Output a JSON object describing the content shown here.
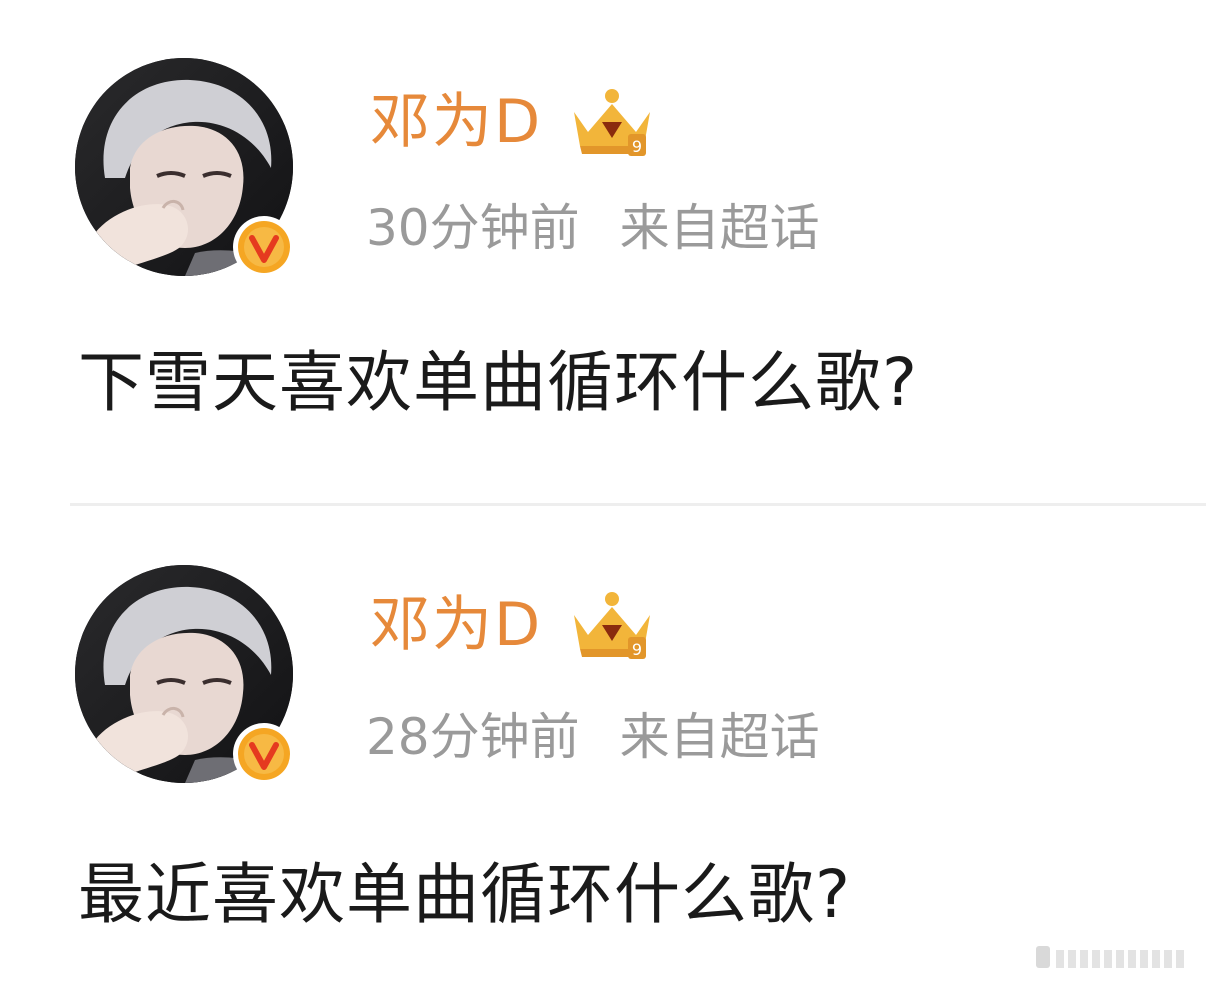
{
  "colors": {
    "username": "#e6893a",
    "meta": "#9a9a9a",
    "text": "#1a1a1a",
    "verified": "#f5a623",
    "crown": "#f2b53a"
  },
  "posts": [
    {
      "username": "邓为D",
      "time": "30分钟前",
      "source": "来自超话",
      "text": "下雪天喜欢单曲循环什么歌?",
      "badge_icon": "crown-level-badge-icon",
      "verified_icon": "verified-v-icon"
    },
    {
      "username": "邓为D",
      "time": "28分钟前",
      "source": "来自超话",
      "text": "最近喜欢单曲循环什么歌?",
      "badge_icon": "crown-level-badge-icon",
      "verified_icon": "verified-v-icon"
    }
  ],
  "watermark_icon": "weibo-watermark-icon"
}
